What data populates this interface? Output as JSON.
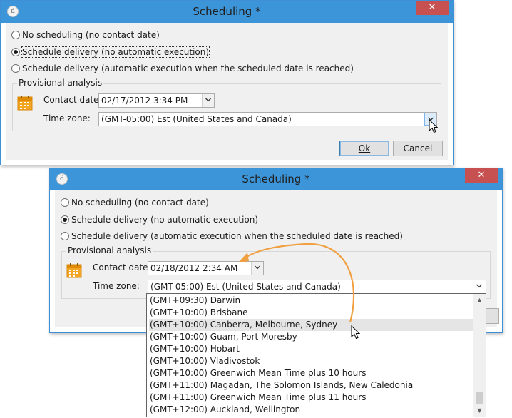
{
  "dialog1": {
    "title": "Scheduling *",
    "close_label": "✕",
    "radios": [
      {
        "label": "No scheduling (no contact date)",
        "checked": false
      },
      {
        "label": "Schedule delivery (no automatic execution)",
        "checked": true
      },
      {
        "label": "Schedule delivery (automatic execution when the scheduled date is reached)",
        "checked": false
      }
    ],
    "group_label": "Provisional analysis",
    "contact_date_label": "Contact date:",
    "contact_date_value": "02/17/2012 3:34 PM",
    "time_zone_label": "Time zone:",
    "time_zone_value": "(GMT-05:00) Est (United States and Canada)",
    "ok_label": "Ok",
    "cancel_label": "Cancel"
  },
  "dialog2": {
    "title": "Scheduling *",
    "close_label": "✕",
    "radios": [
      {
        "label": "No scheduling (no contact date)",
        "checked": false
      },
      {
        "label": "Schedule delivery (no automatic execution)",
        "checked": true
      },
      {
        "label": "Schedule delivery (automatic execution when the scheduled date is reached)",
        "checked": false
      }
    ],
    "group_label": "Provisional analysis",
    "contact_date_label": "Contact date:",
    "contact_date_value": "02/18/2012 2:34 AM",
    "time_zone_label": "Time zone:",
    "time_zone_value": "(GMT-05:00) Est (United States and Canada)"
  },
  "timezone_list": {
    "items": [
      "(GMT+09:30) Darwin",
      "(GMT+10:00) Brisbane",
      "(GMT+10:00) Canberra, Melbourne, Sydney",
      "(GMT+10:00) Guam, Port Moresby",
      "(GMT+10:00) Hobart",
      "(GMT+10:00) Vladivostok",
      "(GMT+10:00) Greenwich Mean Time plus 10 hours",
      "(GMT+11:00) Magadan, The Solomon Islands, New Caledonia",
      "(GMT+11:00) Greenwich Mean Time plus 11 hours",
      "(GMT+12:00) Auckland, Wellington"
    ],
    "highlighted": "(GMT+10:00) Canberra, Melbourne, Sydney"
  },
  "colors": {
    "titlebar": "#3d95d9",
    "close": "#c75050",
    "annotation_arrow": "#f0a040"
  },
  "icons": [
    "app-icon",
    "close-icon",
    "calendar-icon",
    "chevron-down-icon",
    "mouse-cursor-icon",
    "scroll-up-icon",
    "scroll-down-icon"
  ]
}
